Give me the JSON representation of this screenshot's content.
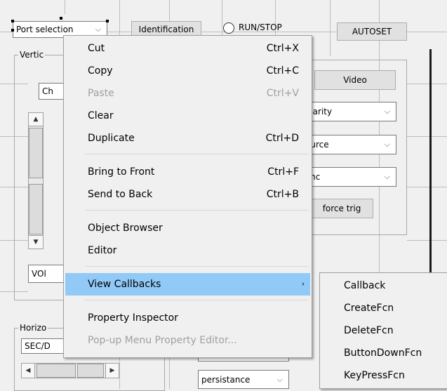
{
  "figure": {
    "port_popup": "Port selection",
    "identification_button": "Identification",
    "runstop_label": "RUN/STOP",
    "autoset_button": "AUTOSET",
    "vertical_panel_title": "Vertic",
    "ch_popup": "Ch",
    "vol_popup": "VOl",
    "horizontal_panel_title": "Horizo",
    "sec_popup": "SEC/D",
    "video_button": "Video",
    "polarity_popup": "olarity",
    "source_popup": "ource",
    "sync_popup": "ync",
    "force_trig_button": "force trig",
    "persistance_popup": "persistance"
  },
  "icons": {
    "chevron": "chevron-down-icon",
    "arrow_up": "▲",
    "arrow_down": "▼",
    "arrow_left": "◀",
    "arrow_right": "▶",
    "submenu_arrow": "›"
  },
  "context_menu": {
    "items": [
      {
        "label": "Cut",
        "shortcut": "Ctrl+X"
      },
      {
        "label": "Copy",
        "shortcut": "Ctrl+C"
      },
      {
        "label": "Paste",
        "shortcut": "Ctrl+V"
      },
      {
        "label": "Clear",
        "shortcut": ""
      },
      {
        "label": "Duplicate",
        "shortcut": "Ctrl+D"
      },
      {
        "label": "Bring to Front",
        "shortcut": "Ctrl+F"
      },
      {
        "label": "Send to Back",
        "shortcut": "Ctrl+B"
      },
      {
        "label": "Object Browser",
        "shortcut": ""
      },
      {
        "label": "Editor",
        "shortcut": ""
      },
      {
        "label": "View Callbacks",
        "shortcut": ""
      },
      {
        "label": "Property Inspector",
        "shortcut": ""
      },
      {
        "label": "Pop-up Menu Property Editor...",
        "shortcut": ""
      }
    ]
  },
  "submenu": {
    "items": [
      "Callback",
      "CreateFcn",
      "DeleteFcn",
      "ButtonDownFcn",
      "KeyPressFcn"
    ]
  },
  "colors": {
    "highlight": "#91c9f7",
    "disabled_text": "#a0a0a0",
    "background": "#f0f0f0"
  }
}
